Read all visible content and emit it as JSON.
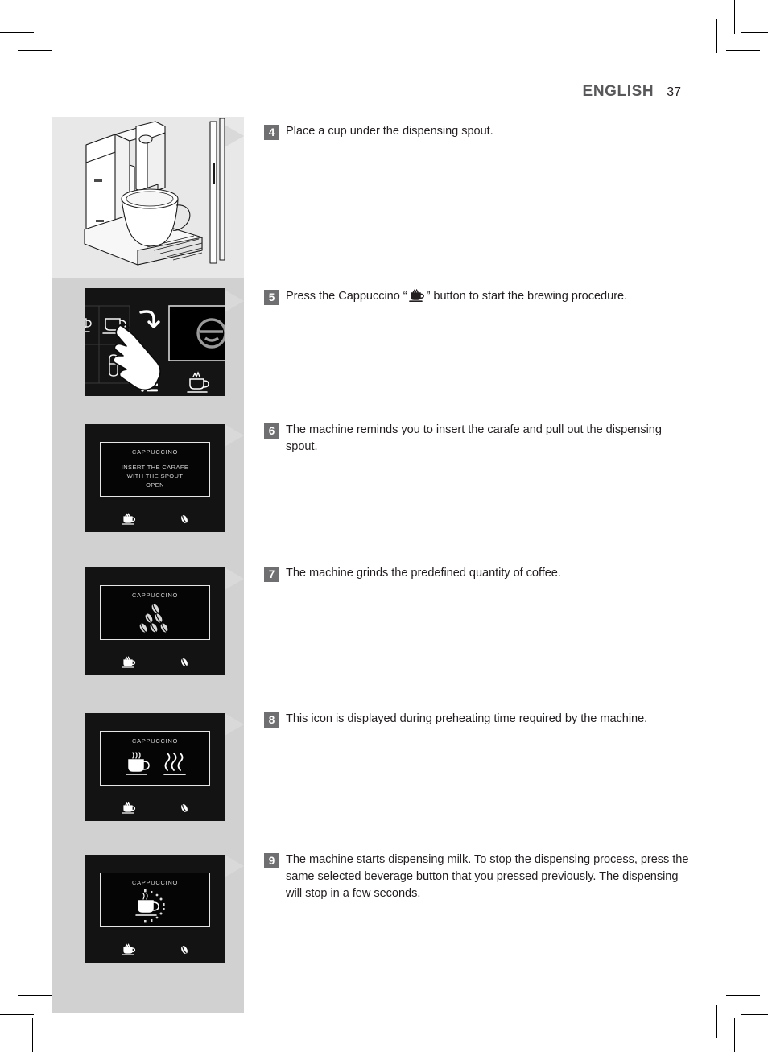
{
  "header": {
    "language": "ENGLISH",
    "page_number": "37"
  },
  "colors": {
    "gray_column": "#d1d1d1",
    "pointer": "#d9d9d9",
    "badge": "#6f6f71",
    "display_bg": "#131313",
    "screen_bg": "#050505",
    "text": "#231f20",
    "header_text": "#58585a"
  },
  "steps": [
    {
      "number": "4",
      "text": "Place a cup under the dispensing spout.",
      "figure": "machine-with-cup-illustration"
    },
    {
      "number": "5",
      "text_before": "Press the Cappuccino “",
      "inline_icon": "cappuccino-cup-icon",
      "text_after": "” button to start the brewing procedure.",
      "figure": "control-panel-hand-press-photo"
    },
    {
      "number": "6",
      "text": "The machine reminds you to insert the carafe and pull out the dispensing spout.",
      "figure": "display-insert-carafe"
    },
    {
      "number": "7",
      "text": "The machine grinds the predefined quantity of coffee.",
      "figure": "display-grinding-beans"
    },
    {
      "number": "8",
      "text": "This icon is displayed during preheating time required by the machine.",
      "figure": "display-preheating"
    },
    {
      "number": "9",
      "text": "The machine starts dispensing milk. To stop the dispensing process, press the same selected beverage button that you pressed previously. The dispensing will stop in a few seconds.",
      "figure": "display-dispensing-milk"
    }
  ],
  "displays": [
    {
      "id": "display-insert-carafe",
      "title": "CAPPUCCINO",
      "message": "INSERT THE CARAFE\nWITH THE SPOUT\nOPEN",
      "graphic": "none",
      "footer_icons": [
        "cup-with-crown-icon",
        "coffee-bean-icon"
      ]
    },
    {
      "id": "display-grinding-beans",
      "title": "CAPPUCCINO",
      "message": "",
      "graphic": "coffee-beans-cluster-icon",
      "footer_icons": [
        "cup-with-crown-icon",
        "coffee-bean-icon"
      ]
    },
    {
      "id": "display-preheating",
      "title": "CAPPUCCINO",
      "message": "",
      "graphic": "steaming-cup-and-heat-waves-icon",
      "footer_icons": [
        "cup-with-crown-icon",
        "coffee-bean-icon"
      ]
    },
    {
      "id": "display-dispensing-milk",
      "title": "CAPPUCCINO",
      "message": "",
      "graphic": "cup-with-progress-dots-icon",
      "footer_icons": [
        "cup-with-crown-icon",
        "coffee-bean-icon"
      ]
    }
  ],
  "control_panel": {
    "icons": [
      "espresso-cup-icon",
      "coffee-cup-icon",
      "back-arrow-icon",
      "milk-glass-icon",
      "menu-list-icon",
      "cup-with-crown-icon",
      "hand-pointer-icon",
      "philips-logo-icon"
    ]
  }
}
